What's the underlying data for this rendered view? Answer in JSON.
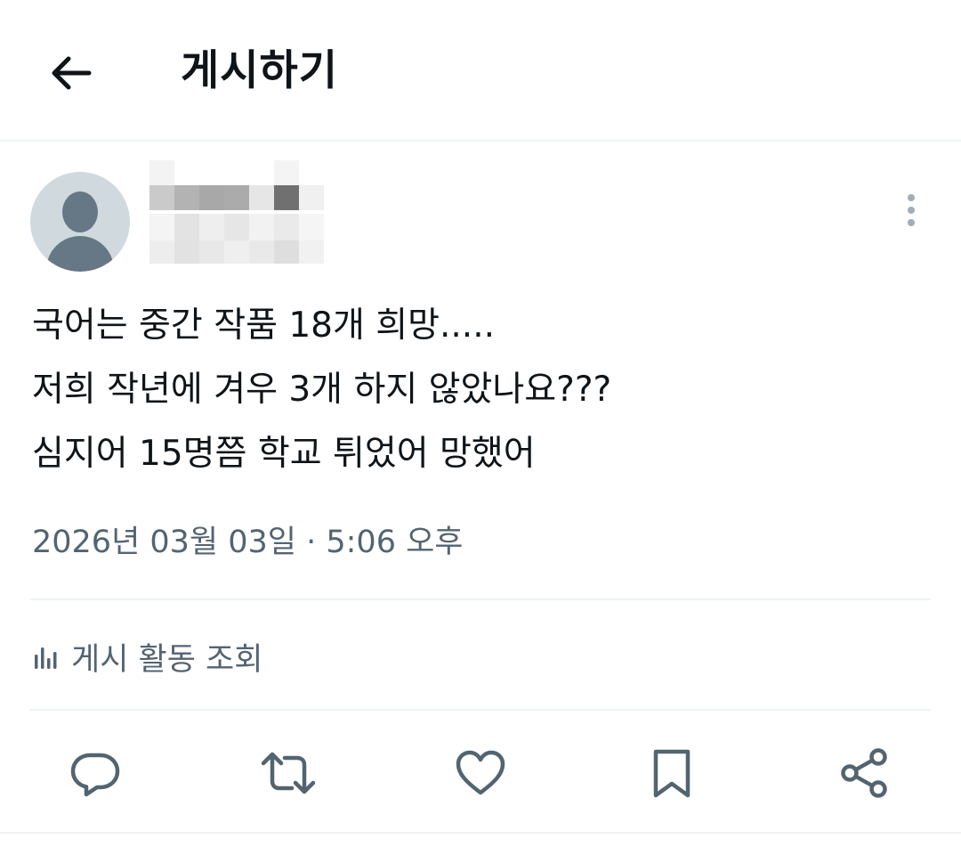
{
  "header": {
    "title": "게시하기",
    "back_icon": "arrow-left-icon"
  },
  "post": {
    "author_redacted": true,
    "text_lines": [
      "국어는 중간 작품 18개 희망.....",
      "저희 작년에 겨우 3개 하지 않았나요???",
      "심지어 15명쯤 학교 튀었어 망했어"
    ],
    "timestamp": "2026년 03월 03일 · 5:06 오후",
    "activity_label": "게시 활동 조회"
  },
  "actions": [
    "reply-icon",
    "repost-icon",
    "like-icon",
    "bookmark-icon",
    "share-icon"
  ],
  "colors": {
    "text": "#0f1419",
    "secondary": "#536471",
    "divider": "#eff3f4",
    "avatar_bg": "#cfd9de",
    "avatar_fg": "#667786"
  }
}
